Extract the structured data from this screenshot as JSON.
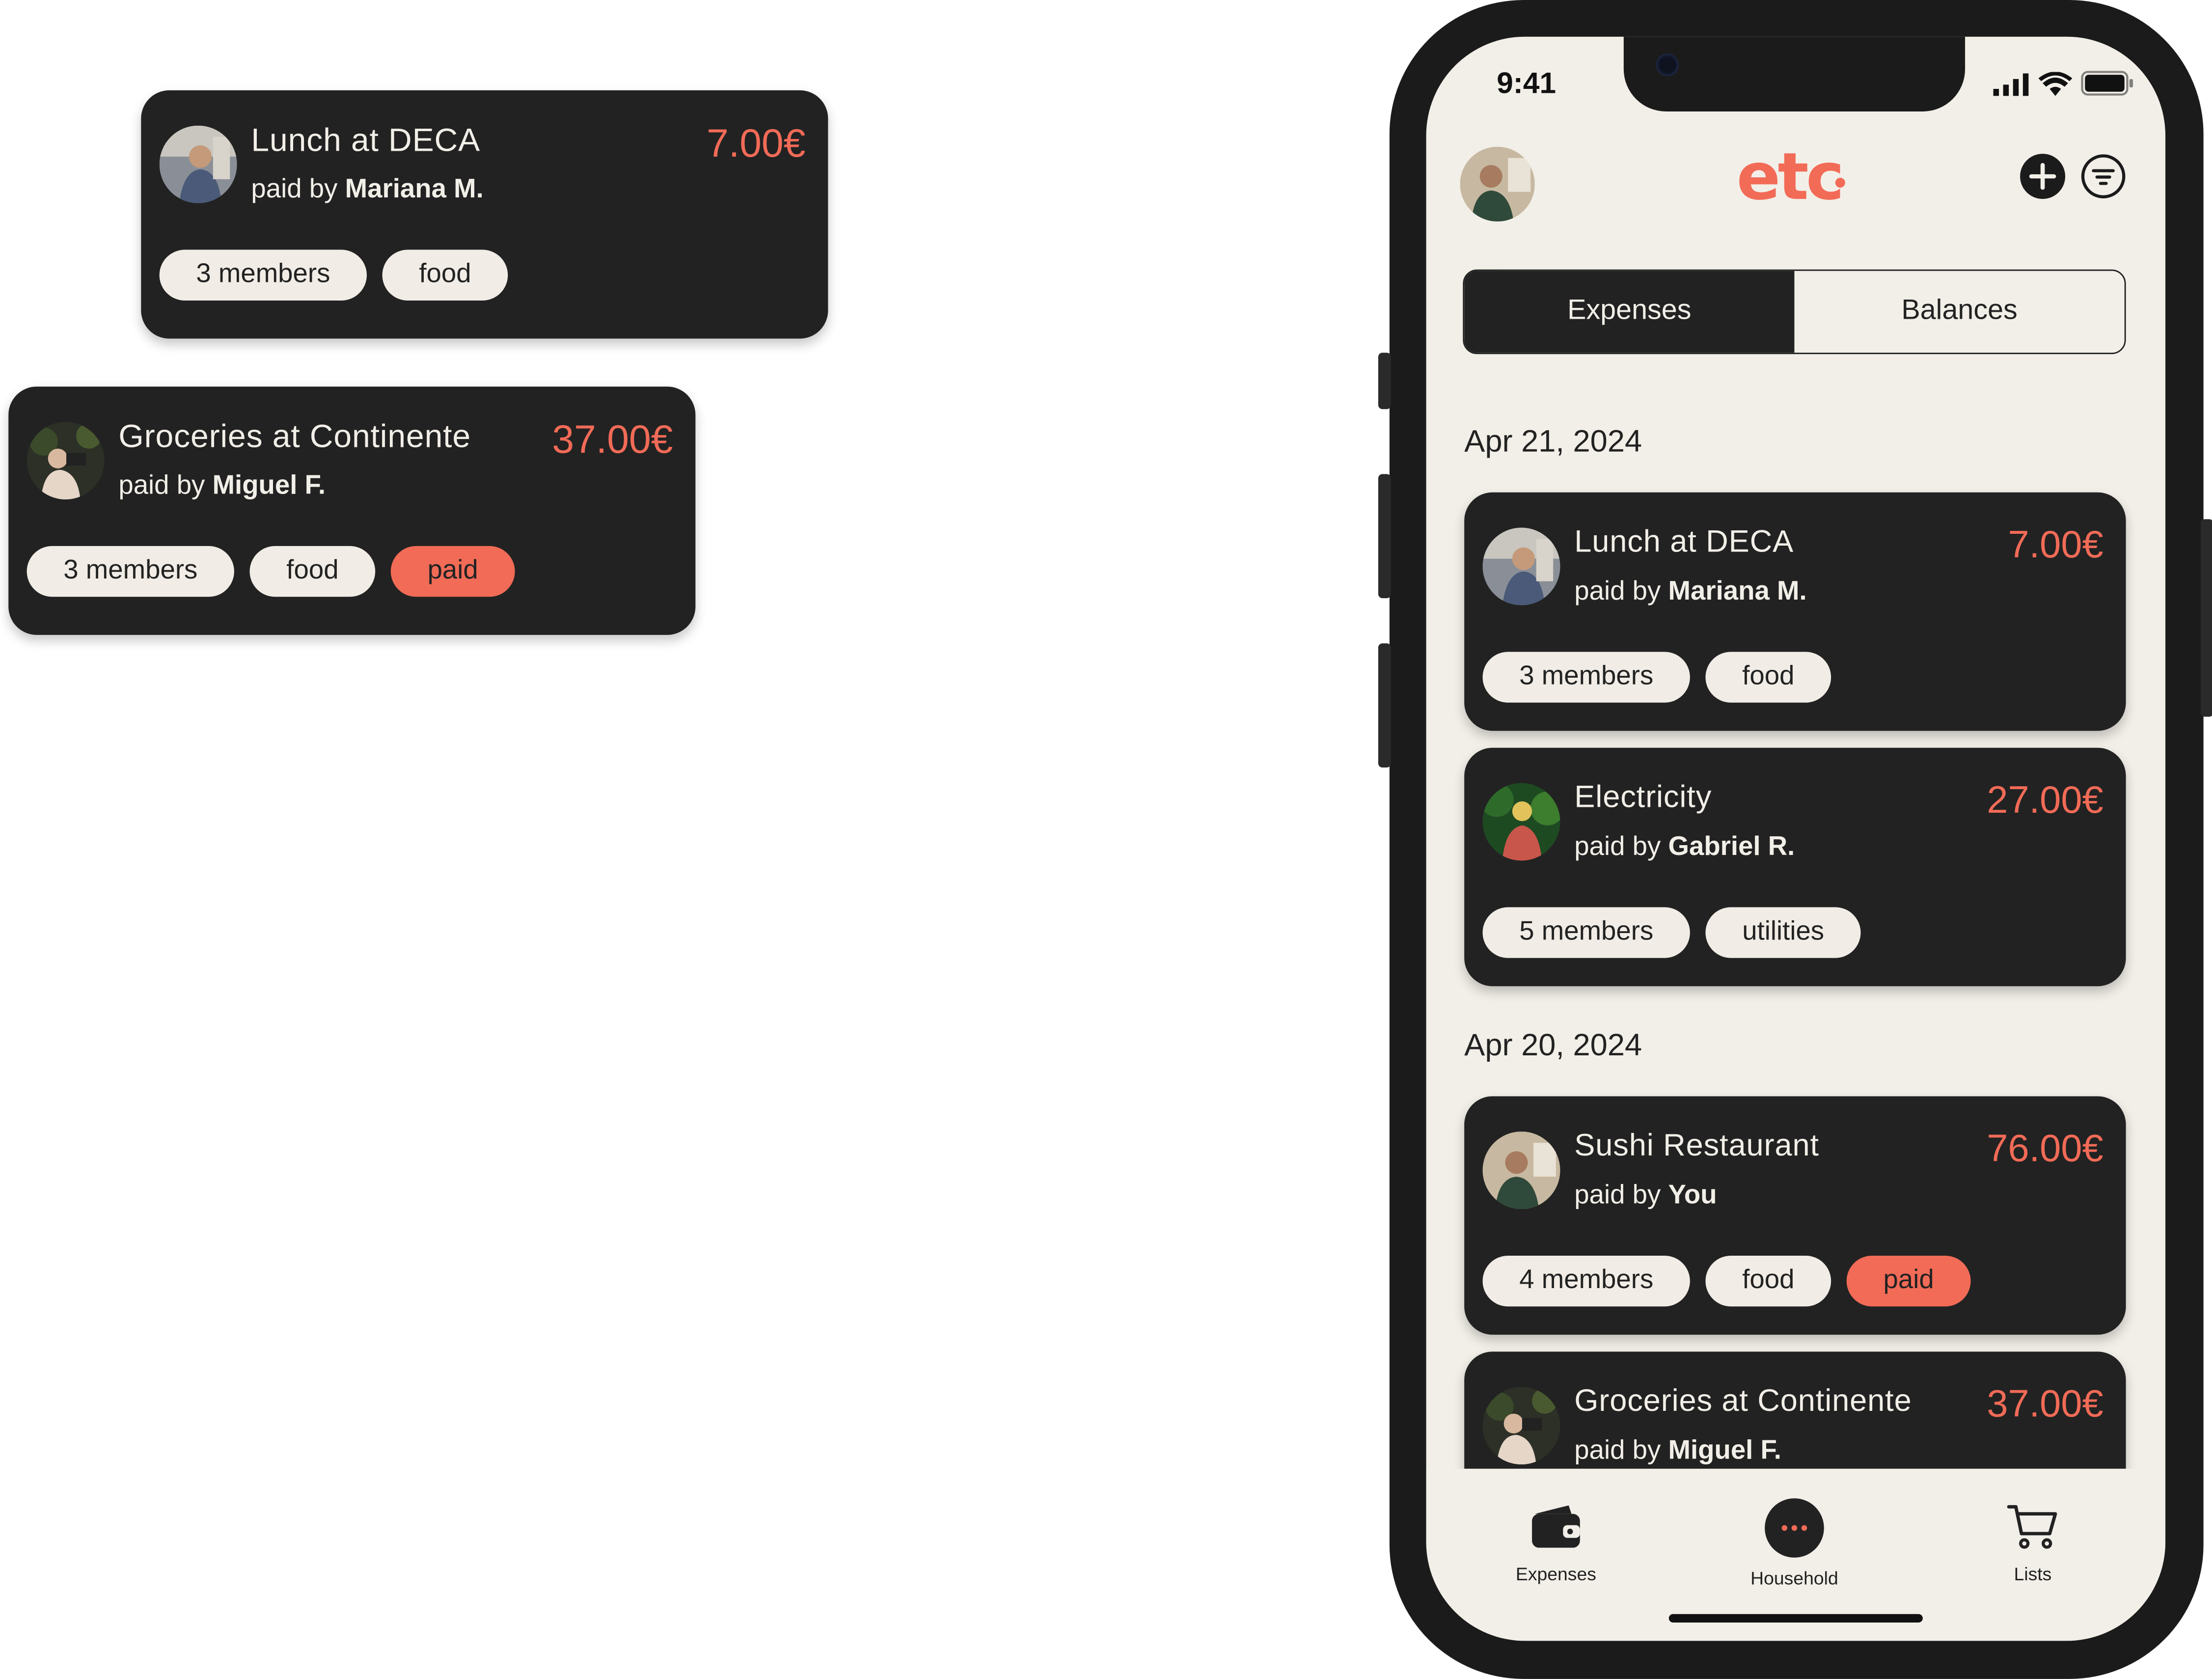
{
  "floating_cards": [
    {
      "title": "Lunch at DECA",
      "payer_prefix": "paid by",
      "payer": "Mariana M.",
      "amount": "7.00€",
      "tags": [
        "3 members",
        "food"
      ]
    },
    {
      "title": "Groceries at Continente",
      "payer_prefix": "paid by",
      "payer": "Miguel F.",
      "amount": "37.00€",
      "tags": [
        "3 members",
        "food"
      ],
      "paid_tag": "paid"
    }
  ],
  "status_bar": {
    "time": "9:41"
  },
  "app": {
    "logo": "etc",
    "tabs": {
      "expenses": "Expenses",
      "balances": "Balances",
      "active": "Expenses"
    }
  },
  "groups": [
    {
      "date": "Apr 21, 2024",
      "expenses": [
        {
          "title": "Lunch at DECA",
          "payer_prefix": "paid by",
          "payer": "Mariana M.",
          "amount": "7.00€",
          "tags": [
            "3 members",
            "food"
          ]
        },
        {
          "title": "Electricity",
          "payer_prefix": "paid by",
          "payer": "Gabriel R.",
          "amount": "27.00€",
          "tags": [
            "5 members",
            "utilities"
          ]
        }
      ]
    },
    {
      "date": "Apr 20, 2024",
      "expenses": [
        {
          "title": "Sushi Restaurant",
          "payer_prefix": "paid by",
          "payer": "You",
          "amount": "76.00€",
          "tags": [
            "4 members",
            "food"
          ],
          "paid_tag": "paid"
        },
        {
          "title": "Groceries at Continente",
          "payer_prefix": "paid by",
          "payer": "Miguel F.",
          "amount": "37.00€"
        }
      ]
    }
  ],
  "bottom_nav": {
    "expenses": "Expenses",
    "household": "Household",
    "lists": "Lists"
  },
  "colors": {
    "accent": "#f26b57",
    "card_bg": "#222222",
    "screen_bg": "#f2efe8"
  }
}
